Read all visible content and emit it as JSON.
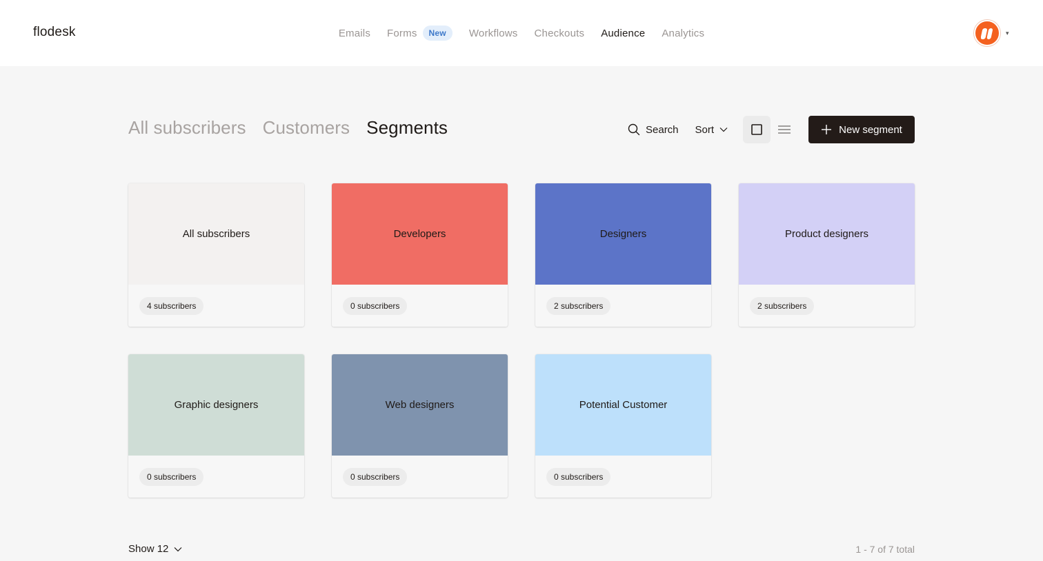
{
  "app": {
    "logo": "flodesk"
  },
  "nav": {
    "items": [
      {
        "label": "Emails",
        "active": false
      },
      {
        "label": "Forms",
        "badge": "New",
        "active": false
      },
      {
        "label": "Workflows",
        "active": false
      },
      {
        "label": "Checkouts",
        "active": false
      },
      {
        "label": "Audience",
        "active": true
      },
      {
        "label": "Analytics",
        "active": false
      }
    ]
  },
  "header": {
    "tabs": [
      {
        "label": "All subscribers",
        "active": false
      },
      {
        "label": "Customers",
        "active": false
      },
      {
        "label": "Segments",
        "active": true
      }
    ],
    "search_label": "Search",
    "sort_label": "Sort",
    "new_segment_label": "New segment"
  },
  "segments": [
    {
      "name": "All subscribers",
      "count": "4 subscribers",
      "color": "#f3f1f0"
    },
    {
      "name": "Developers",
      "count": "0 subscribers",
      "color": "#f06d64"
    },
    {
      "name": "Designers",
      "count": "2 subscribers",
      "color": "#5c74c8"
    },
    {
      "name": "Product designers",
      "count": "2 subscribers",
      "color": "#d3d0f6"
    },
    {
      "name": "Graphic designers",
      "count": "0 subscribers",
      "color": "#cfddd6"
    },
    {
      "name": "Web designers",
      "count": "0 subscribers",
      "color": "#7f93ae"
    },
    {
      "name": "Potential Customer",
      "count": "0 subscribers",
      "color": "#bde0fb"
    }
  ],
  "footer": {
    "show_label": "Show 12",
    "total_label": "1 - 7 of 7 total"
  }
}
